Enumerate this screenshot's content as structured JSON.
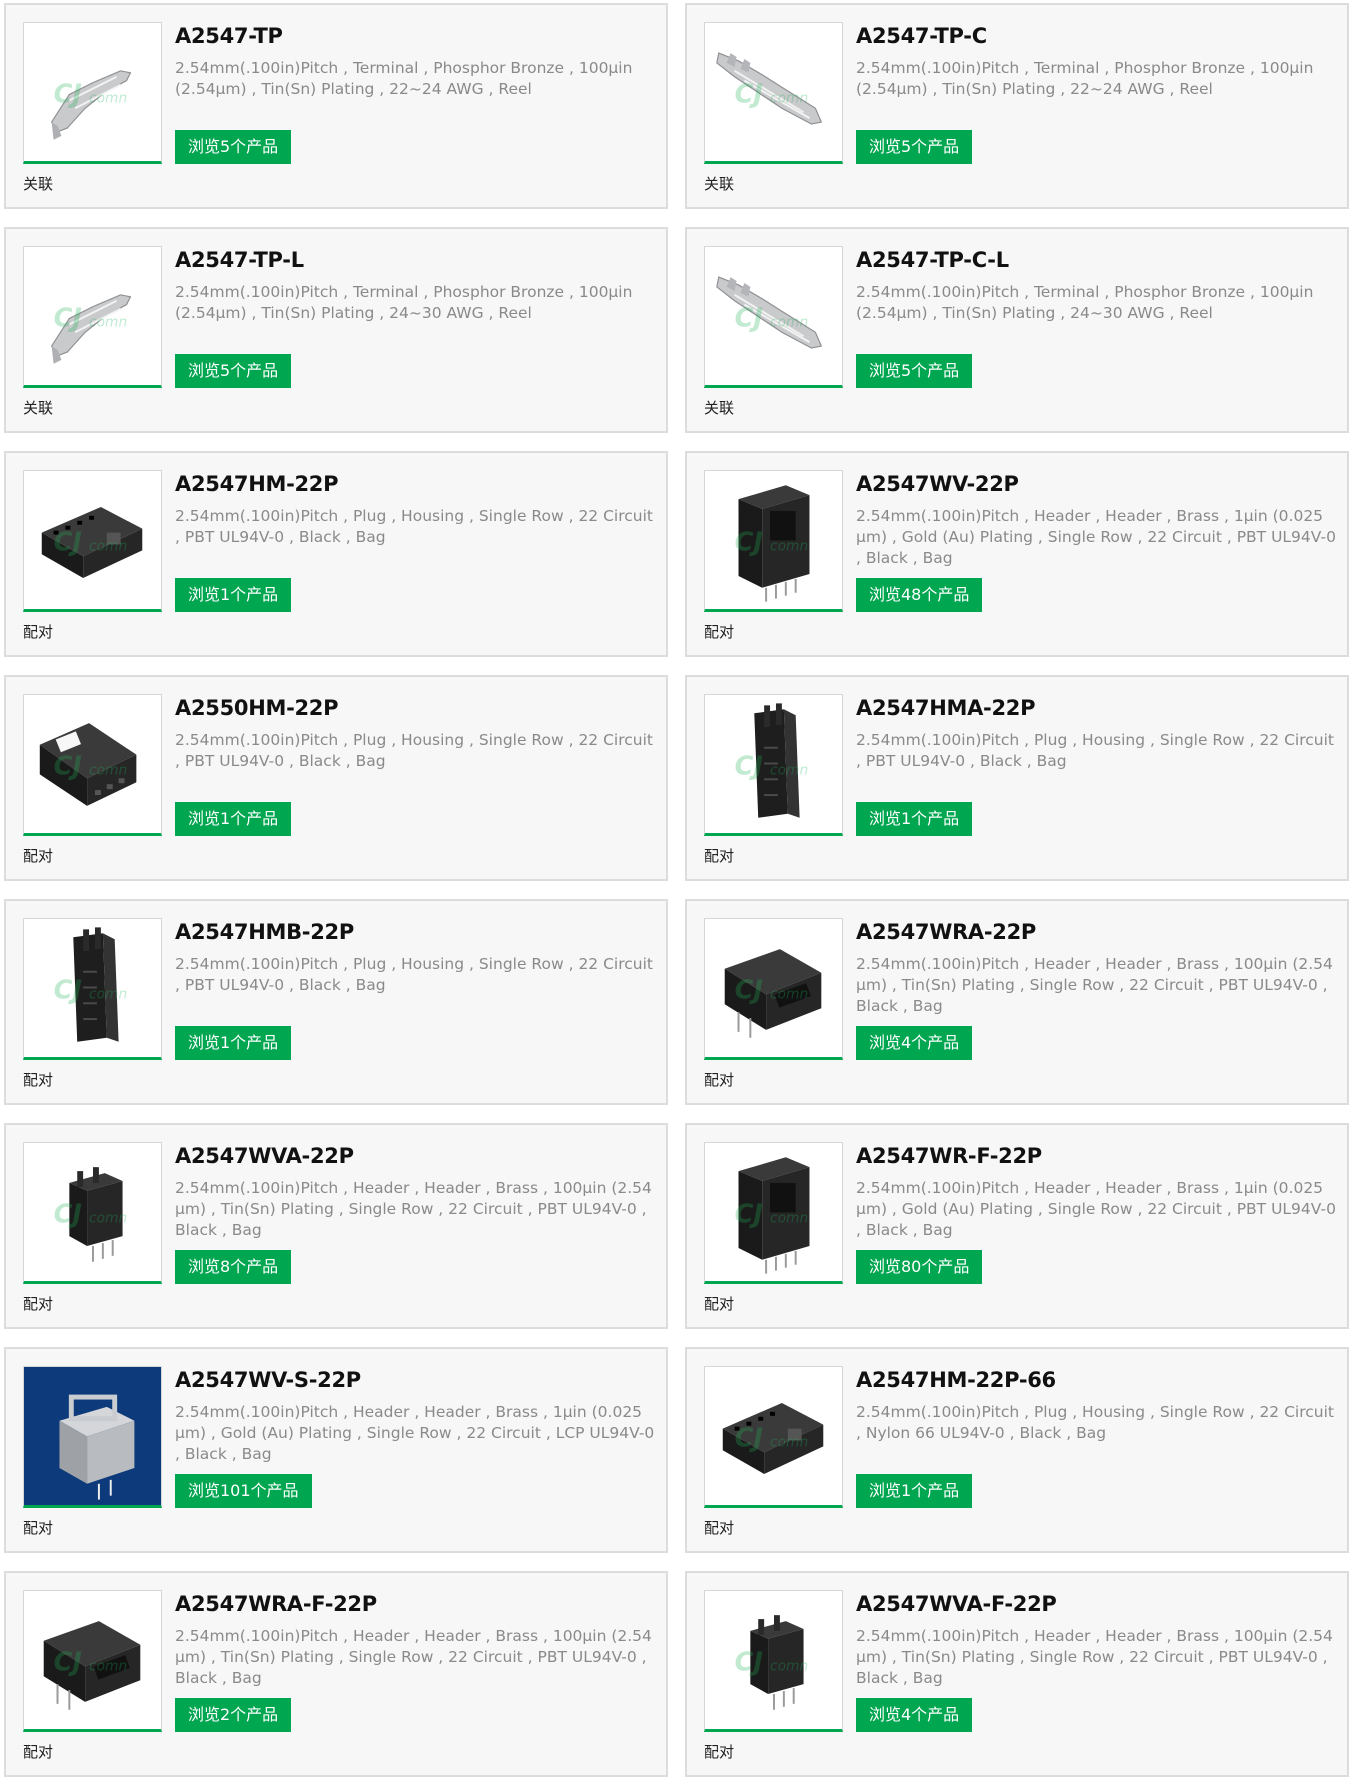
{
  "colors": {
    "accent": "#00a650",
    "card_bg": "#f7f7f7",
    "card_border": "#dcdcdc",
    "desc_text": "#8a8a8a"
  },
  "products": [
    {
      "title": "A2547-TP",
      "desc": "2.54mm(.100in)Pitch , Terminal , Phosphor Bronze , 100μin (2.54μm) , Tin(Sn) Plating , 22~24 AWG , Reel",
      "button": "浏览5个产品",
      "relation": "关联",
      "thumb": "terminal-small"
    },
    {
      "title": "A2547-TP-C",
      "desc": "2.54mm(.100in)Pitch , Terminal , Phosphor Bronze , 100μin (2.54μm) , Tin(Sn) Plating , 22~24 AWG , Reel",
      "button": "浏览5个产品",
      "relation": "关联",
      "thumb": "terminal-large"
    },
    {
      "title": "A2547-TP-L",
      "desc": "2.54mm(.100in)Pitch , Terminal , Phosphor Bronze , 100μin (2.54μm) , Tin(Sn) Plating , 24~30 AWG , Reel",
      "button": "浏览5个产品",
      "relation": "关联",
      "thumb": "terminal-small"
    },
    {
      "title": "A2547-TP-C-L",
      "desc": "2.54mm(.100in)Pitch , Terminal , Phosphor Bronze , 100μin (2.54μm) , Tin(Sn) Plating , 24~30 AWG , Reel",
      "button": "浏览5个产品",
      "relation": "关联",
      "thumb": "terminal-large"
    },
    {
      "title": "A2547HM-22P",
      "desc": "2.54mm(.100in)Pitch , Plug , Housing , Single Row , 22 Circuit , PBT UL94V-0 , Black , Bag",
      "button": "浏览1个产品",
      "relation": "配对",
      "thumb": "housing-flat"
    },
    {
      "title": "A2547WV-22P",
      "desc": "2.54mm(.100in)Pitch , Header , Header , Brass , 1μin (0.025 μm) , Gold (Au) Plating , Single Row , 22 Circuit , PBT UL94V-0 , Black , Bag",
      "button": "浏览48个产品",
      "relation": "配对",
      "thumb": "header-vertical"
    },
    {
      "title": "A2550HM-22P",
      "desc": "2.54mm(.100in)Pitch , Plug , Housing , Single Row , 22 Circuit , PBT UL94V-0 , Black , Bag",
      "button": "浏览1个产品",
      "relation": "配对",
      "thumb": "housing-latch"
    },
    {
      "title": "A2547HMA-22P",
      "desc": "2.54mm(.100in)Pitch , Plug , Housing , Single Row , 22 Circuit , PBT UL94V-0 , Black , Bag",
      "button": "浏览1个产品",
      "relation": "配对",
      "thumb": "housing-tall"
    },
    {
      "title": "A2547HMB-22P",
      "desc": "2.54mm(.100in)Pitch , Plug , Housing , Single Row , 22 Circuit , PBT UL94V-0 , Black , Bag",
      "button": "浏览1个产品",
      "relation": "配对",
      "thumb": "housing-tall"
    },
    {
      "title": "A2547WRA-22P",
      "desc": "2.54mm(.100in)Pitch , Header , Header , Brass , 100μin (2.54 μm) , Tin(Sn) Plating , Single Row , 22 Circuit , PBT UL94V-0 , Black , Bag",
      "button": "浏览4个产品",
      "relation": "配对",
      "thumb": "header-right-angle"
    },
    {
      "title": "A2547WVA-22P",
      "desc": "2.54mm(.100in)Pitch , Header , Header , Brass , 100μin (2.54 μm) , Tin(Sn) Plating , Single Row , 22 Circuit , PBT UL94V-0 , Black , Bag",
      "button": "浏览8个产品",
      "relation": "配对",
      "thumb": "header-small"
    },
    {
      "title": "A2547WR-F-22P",
      "desc": "2.54mm(.100in)Pitch , Header , Header , Brass , 1μin (0.025 μm) , Gold (Au) Plating , Single Row , 22 Circuit , PBT UL94V-0 , Black , Bag",
      "button": "浏览80个产品",
      "relation": "配对",
      "thumb": "header-vertical"
    },
    {
      "title": "A2547WV-S-22P",
      "desc": "2.54mm(.100in)Pitch , Header , Header , Brass , 1μin (0.025 μm) , Gold (Au) Plating , Single Row , 22 Circuit , LCP UL94V-0 , Black , Bag",
      "button": "浏览101个产品",
      "relation": "配对",
      "thumb": "header-smt-render"
    },
    {
      "title": "A2547HM-22P-66",
      "desc": "2.54mm(.100in)Pitch , Plug , Housing , Single Row , 22 Circuit , Nylon 66 UL94V-0 , Black , Bag",
      "button": "浏览1个产品",
      "relation": "配对",
      "thumb": "housing-flat"
    },
    {
      "title": "A2547WRA-F-22P",
      "desc": "2.54mm(.100in)Pitch , Header , Header , Brass , 100μin (2.54 μm) , Tin(Sn) Plating , Single Row , 22 Circuit , PBT UL94V-0 , Black , Bag",
      "button": "浏览2个产品",
      "relation": "配对",
      "thumb": "header-right-angle"
    },
    {
      "title": "A2547WVA-F-22P",
      "desc": "2.54mm(.100in)Pitch , Header , Header , Brass , 100μin (2.54 μm) , Tin(Sn) Plating , Single Row , 22 Circuit , PBT UL94V-0 , Black , Bag",
      "button": "浏览4个产品",
      "relation": "配对",
      "thumb": "header-small"
    }
  ]
}
